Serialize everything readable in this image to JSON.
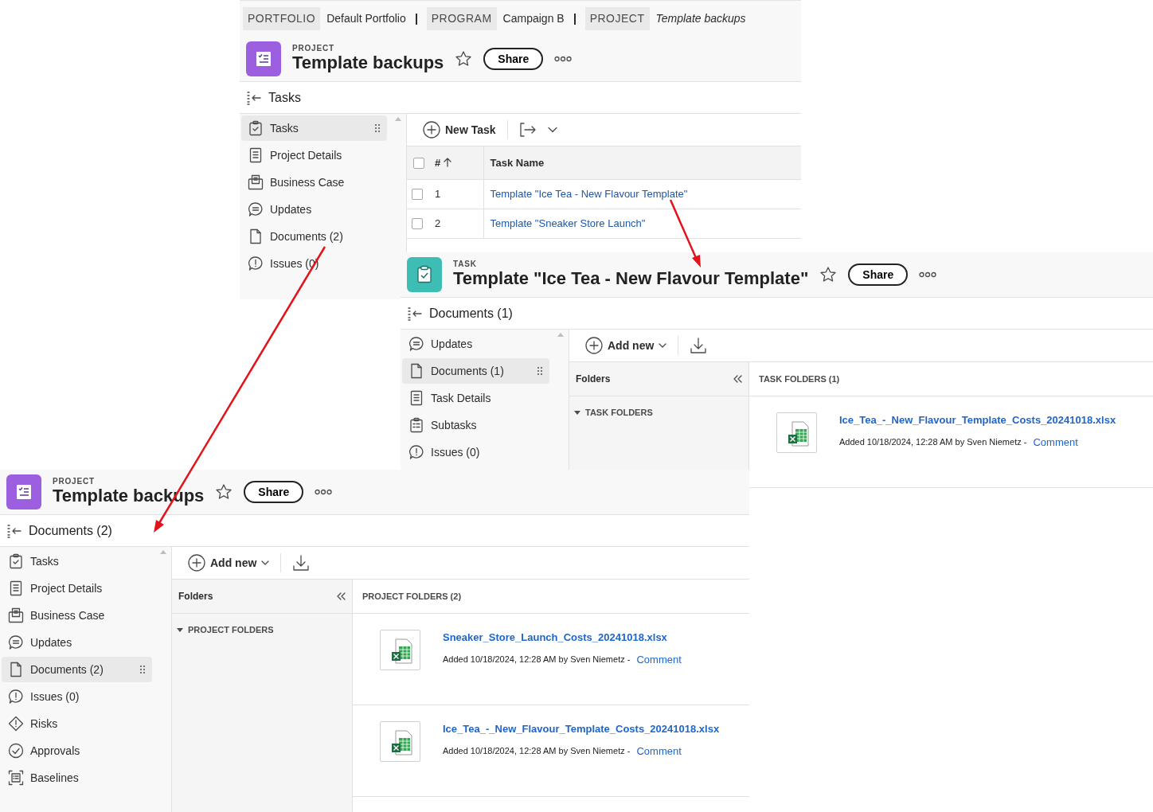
{
  "panels": [
    {
      "kind": "tasks",
      "breadcrumb": [
        {
          "tag": "PORTFOLIO",
          "name": "Default Portfolio"
        },
        {
          "tag": "PROGRAM",
          "name": "Campaign B"
        },
        {
          "tag": "PROJECT",
          "name": "Template backups"
        }
      ],
      "object": {
        "label": "PROJECT",
        "kind": "project"
      },
      "title": "Template backups",
      "share": "Share",
      "section": "Tasks",
      "nav": [
        {
          "kind": "tasks",
          "label": "Tasks",
          "selected": true
        },
        {
          "kind": "details",
          "label": "Project Details",
          "selected": false
        },
        {
          "kind": "business",
          "label": "Business Case",
          "selected": false
        },
        {
          "kind": "updates",
          "label": "Updates",
          "selected": false
        },
        {
          "kind": "documents",
          "label": "Documents (2)",
          "selected": false
        },
        {
          "kind": "issues",
          "label": "Issues (0)",
          "selected": false
        }
      ],
      "new_button": "New Task",
      "columns": [
        "#",
        "Task Name"
      ],
      "header_checked": false,
      "rows": [
        {
          "number": "1",
          "name": "Template \"Ice Tea - New Flavour Template\"",
          "checked": false
        },
        {
          "number": "2",
          "name": "Template \"Sneaker Store Launch\"",
          "checked": false
        }
      ]
    },
    {
      "kind": "documents",
      "object": {
        "label": "TASK",
        "kind": "task"
      },
      "title": "Template \"Ice Tea - New Flavour Template\"",
      "share": "Share",
      "section": "Documents (1)",
      "nav": [
        {
          "kind": "updates",
          "label": "Updates",
          "selected": false
        },
        {
          "kind": "documents",
          "label": "Documents (1)",
          "selected": true
        },
        {
          "kind": "details",
          "label": "Task Details",
          "selected": false
        },
        {
          "kind": "subtasks",
          "label": "Subtasks",
          "selected": false
        },
        {
          "kind": "issues",
          "label": "Issues (0)",
          "selected": false
        }
      ],
      "add_button": "Add new",
      "folders_label": "Folders",
      "folder_group": "TASK FOLDERS",
      "list_heading": "TASK FOLDERS (1)",
      "files": [
        {
          "name": "Ice_Tea_-_New_Flavour_Template_Costs_20241018.xlsx",
          "added": "Added 10/18/2024, 12:28 AM by Sven Niemetz -",
          "comment": "Comment"
        }
      ]
    },
    {
      "kind": "documents",
      "object": {
        "label": "PROJECT",
        "kind": "project"
      },
      "title": "Template backups",
      "share": "Share",
      "section": "Documents (2)",
      "nav": [
        {
          "kind": "tasks",
          "label": "Tasks",
          "selected": false
        },
        {
          "kind": "details",
          "label": "Project Details",
          "selected": false
        },
        {
          "kind": "business",
          "label": "Business Case",
          "selected": false
        },
        {
          "kind": "updates",
          "label": "Updates",
          "selected": false
        },
        {
          "kind": "documents",
          "label": "Documents (2)",
          "selected": true
        },
        {
          "kind": "issues",
          "label": "Issues (0)",
          "selected": false
        },
        {
          "kind": "risks",
          "label": "Risks",
          "selected": false
        },
        {
          "kind": "approvals",
          "label": "Approvals",
          "selected": false
        },
        {
          "kind": "baselines",
          "label": "Baselines",
          "selected": false
        }
      ],
      "add_button": "Add new",
      "folders_label": "Folders",
      "folder_group": "PROJECT FOLDERS",
      "list_heading": "PROJECT FOLDERS (2)",
      "files": [
        {
          "name": "Sneaker_Store_Launch_Costs_20241018.xlsx",
          "added": "Added 10/18/2024, 12:28 AM by Sven Niemetz -",
          "comment": "Comment"
        },
        {
          "name": "Ice_Tea_-_New_Flavour_Template_Costs_20241018.xlsx",
          "added": "Added 10/18/2024, 12:28 AM by Sven Niemetz -",
          "comment": "Comment"
        }
      ]
    }
  ]
}
